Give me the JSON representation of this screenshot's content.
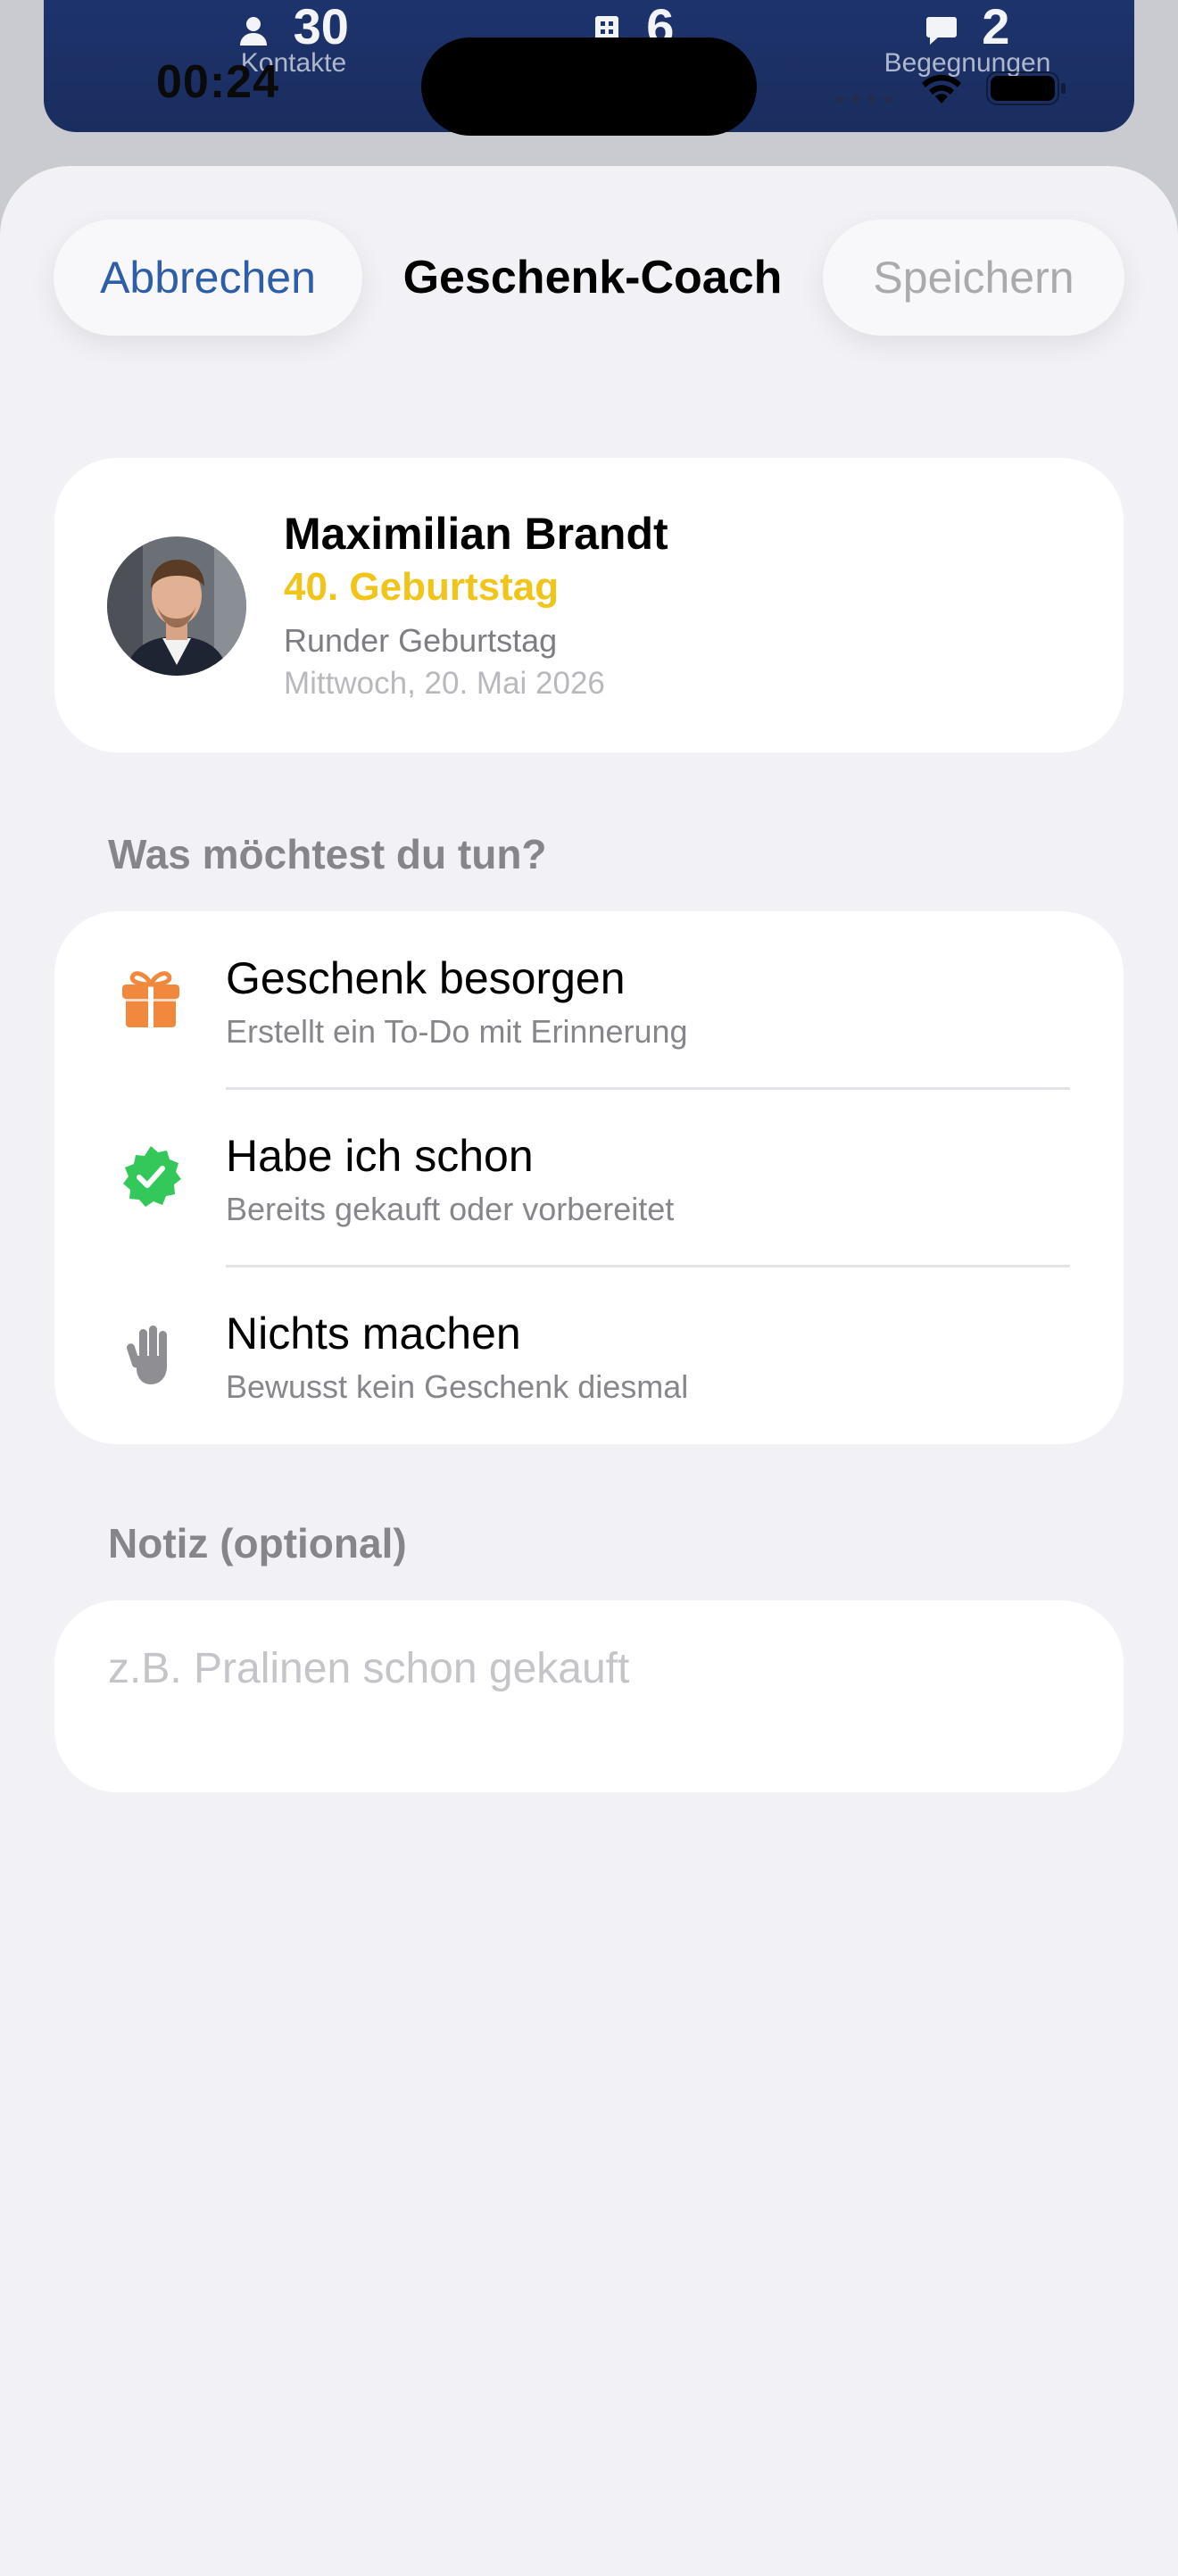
{
  "background": {
    "stats": [
      {
        "value": "30",
        "label": "Kontakte",
        "icon": "person-icon"
      },
      {
        "value": "6",
        "label": "",
        "icon": "building-icon"
      },
      {
        "value": "2",
        "label": "Begegnungen",
        "icon": "speech-bubble-icon"
      }
    ],
    "card_color": "#1e3570"
  },
  "status_bar": {
    "time": "00:24",
    "icons": [
      "signal-icon",
      "wifi-icon",
      "battery-icon"
    ]
  },
  "sheet": {
    "nav": {
      "cancel_label": "Abbrechen",
      "title": "Geschenk-Coach",
      "save_label": "Speichern"
    },
    "person": {
      "name": "Maximilian Brandt",
      "occasion": "40. Geburtstag",
      "occasion_type": "Runder Geburtstag",
      "date": "Mittwoch, 20. Mai 2026"
    },
    "actions": {
      "heading": "Was möchtest du tun?",
      "options": [
        {
          "title": "Geschenk besorgen",
          "subtitle": "Erstellt ein To-Do mit Erinnerung",
          "icon": "gift-icon",
          "color": "#f0883e"
        },
        {
          "title": "Habe ich schon",
          "subtitle": "Bereits gekauft oder vorbereitet",
          "icon": "checkmark-seal-icon",
          "color": "#34c759"
        },
        {
          "title": "Nichts machen",
          "subtitle": "Bewusst kein Geschenk diesmal",
          "icon": "hand-raised-icon",
          "color": "#8e8e93"
        }
      ]
    },
    "note": {
      "heading": "Notiz (optional)",
      "placeholder": "z.B. Pralinen schon gekauft",
      "value": ""
    }
  },
  "colors": {
    "accent": "#2f5ea8",
    "occasion": "#f0c419",
    "sheet_background": "#f1f1f6"
  }
}
